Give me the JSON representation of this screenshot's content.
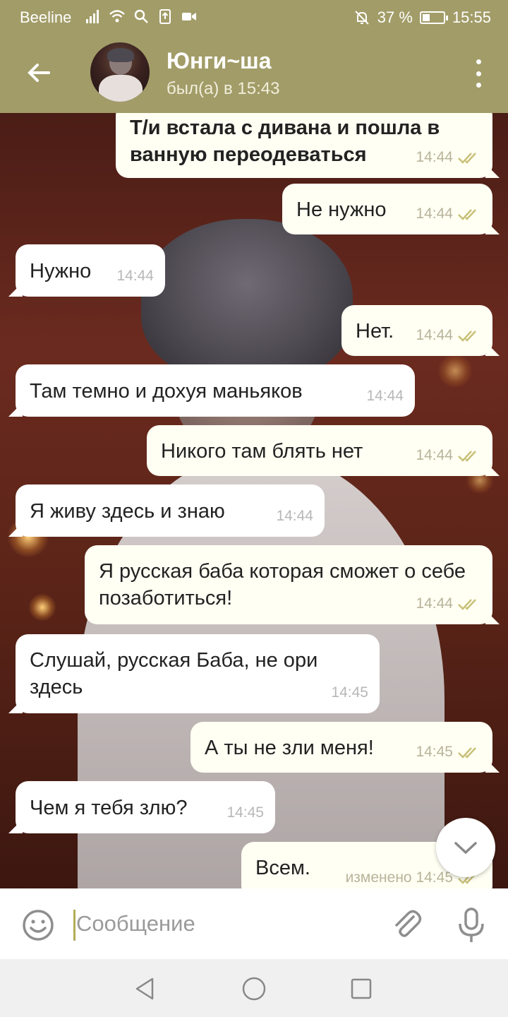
{
  "status_bar": {
    "carrier": "Beeline",
    "battery_percent": "37 %",
    "battery_level": 0.37,
    "time": "15:55",
    "icons": [
      "signal-icon",
      "wifi-icon",
      "search-icon",
      "upload-icon",
      "video-icon",
      "mute-icon",
      "battery-icon"
    ]
  },
  "header": {
    "name": "Юнги~ша",
    "last_seen": "был(а) в 15:43"
  },
  "messages": [
    {
      "dir": "out",
      "text": "Т/и встала с дивана и пошла в ванную переодеваться",
      "time": "14:44",
      "read": true
    },
    {
      "dir": "out",
      "text": "Не нужно",
      "time": "14:44",
      "read": true
    },
    {
      "dir": "in",
      "text": "Нужно",
      "time": "14:44"
    },
    {
      "dir": "out",
      "text": "Нет.",
      "time": "14:44",
      "read": true
    },
    {
      "dir": "in",
      "text": "Там темно и дохуя маньяков",
      "time": "14:44"
    },
    {
      "dir": "out",
      "text": "Никого там блять нет",
      "time": "14:44",
      "read": true
    },
    {
      "dir": "in",
      "text": "Я живу здесь и знаю",
      "time": "14:44"
    },
    {
      "dir": "out",
      "text": "Я русская баба которая сможет о себе позаботиться!",
      "time": "14:44",
      "read": true
    },
    {
      "dir": "in",
      "text": "Слушай, русская Баба, не ори здесь",
      "time": "14:45"
    },
    {
      "dir": "out",
      "text": "А ты не зли меня!",
      "time": "14:45",
      "read": true
    },
    {
      "dir": "in",
      "text": "Чем я тебя злю?",
      "time": "14:45"
    },
    {
      "dir": "out",
      "text": "Всем.",
      "time": "изменено 14:45",
      "read": true
    }
  ],
  "input": {
    "placeholder": "Сообщение"
  },
  "colors": {
    "accent": "#a29c68",
    "bubble_out": "#fffff3",
    "bubble_in": "#ffffff",
    "check": "#c8c078"
  }
}
